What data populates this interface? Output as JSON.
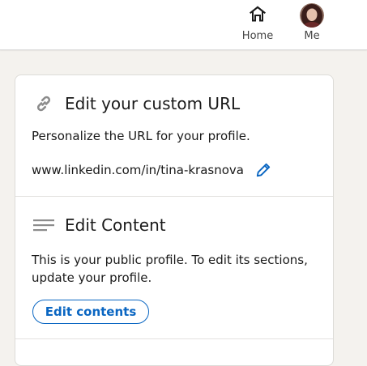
{
  "nav": {
    "home_label": "Home",
    "home_icon": "home-icon",
    "me_label": "Me",
    "me_icon": "avatar"
  },
  "custom_url": {
    "heading": "Edit your custom URL",
    "icon": "link-icon",
    "description": "Personalize the URL for your profile.",
    "url": "www.linkedin.com/in/tina-krasnova",
    "edit_icon": "pencil-icon"
  },
  "content": {
    "heading": "Edit Content",
    "icon": "lines-icon",
    "description": "This is your public profile. To edit its sections, update your profile.",
    "button_label": "Edit contents"
  },
  "colors": {
    "accent": "#0a66c2",
    "background": "#f4f2ee",
    "card": "#ffffff"
  }
}
